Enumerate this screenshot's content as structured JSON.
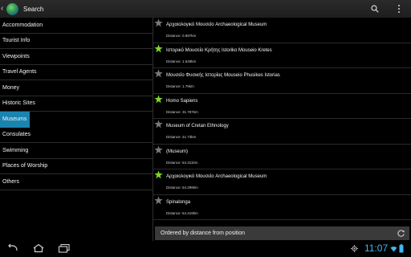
{
  "actionbar": {
    "title": "Search",
    "search_icon": "search-icon",
    "overflow_icon": "overflow-menu-icon"
  },
  "sidebar": {
    "items": [
      {
        "label": "Accommodation"
      },
      {
        "label": "Tourist Info"
      },
      {
        "label": "Viewpoints"
      },
      {
        "label": "Travel Agents"
      },
      {
        "label": "Money"
      },
      {
        "label": "Historic Sites"
      },
      {
        "label": "Museums",
        "selected": true
      },
      {
        "label": "Consulates"
      },
      {
        "label": "Swimming"
      },
      {
        "label": "Places of Worship"
      },
      {
        "label": "Others"
      }
    ]
  },
  "results": [
    {
      "title": "Αρχαιολογικό Μουσείο Archaeological Museum",
      "distance": "Distance: 0.997km",
      "favorite": false
    },
    {
      "title": "Ιστορικό Μουσείο Κρήτης Istoriko Mouseio Kretes",
      "distance": "Distance: 1.549km",
      "favorite": true
    },
    {
      "title": "Μουσείο Φυσικής Ιστορίας Mouseio Phusikes Istorias",
      "distance": "Distance: 1.79km",
      "favorite": false
    },
    {
      "title": "Homo Sapiens",
      "distance": "Distance: 31.787km",
      "favorite": true
    },
    {
      "title": "Museum of Cretan Ethnology",
      "distance": "Distance: 41.73km",
      "favorite": false
    },
    {
      "title": "(Museum)",
      "distance": "Distance: 54.311km",
      "favorite": false
    },
    {
      "title": "Αρχαιολογικό Μουσείο Archaeological Museum",
      "distance": "Distance: 54.299km",
      "favorite": true
    },
    {
      "title": "Spinalonga",
      "distance": "Distance: 54.419km",
      "favorite": false
    }
  ],
  "sortbar": {
    "label": "Ordered by distance from position"
  },
  "statusbar": {
    "time": "11:07"
  },
  "colors": {
    "accent": "#1a84b0",
    "star_on": "#7fd62d",
    "star_off": "#7a7a7a",
    "clock": "#3fb8f0"
  }
}
